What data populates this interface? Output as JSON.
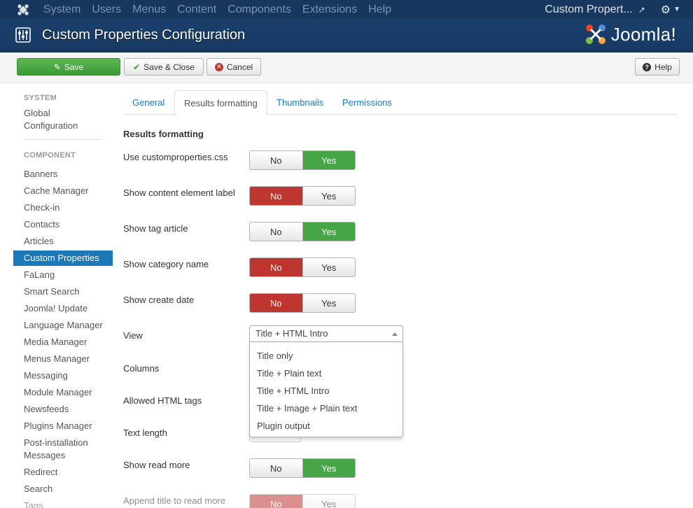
{
  "topbar": {
    "menu": [
      "System",
      "Users",
      "Menus",
      "Content",
      "Components",
      "Extensions",
      "Help"
    ],
    "site_link": "Custom Propert...",
    "icons": [
      "joomla-icon",
      "external-link-icon",
      "gear-icon",
      "caret-down-icon"
    ]
  },
  "header": {
    "title": "Custom Properties Configuration",
    "brand": "Joomla!"
  },
  "toolbar": {
    "save": "Save",
    "save_close": "Save & Close",
    "cancel": "Cancel",
    "help": "Help"
  },
  "sidebar": {
    "system_head": "SYSTEM",
    "global_config": [
      "Global",
      "Configuration"
    ],
    "component_head": "COMPONENT",
    "items": [
      "Banners",
      "Cache Manager",
      "Check-in",
      "Contacts",
      "Articles",
      "Custom Properties",
      "FaLang",
      "Smart Search",
      "Joomla! Update",
      "Language Manager",
      "Media Manager",
      "Menus Manager",
      "Messaging",
      "Module Manager",
      "Newsfeeds",
      "Plugins Manager"
    ],
    "post_install": [
      "Post-installation",
      "Messages"
    ],
    "items2": [
      "Redirect",
      "Search",
      "Tags"
    ],
    "active": "Custom Properties"
  },
  "tabs": [
    "General",
    "Results formatting",
    "Thumbnails",
    "Permissions"
  ],
  "active_tab": "Results formatting",
  "form": {
    "section_title": "Results formatting",
    "fields": [
      {
        "label": "Use customproperties.css",
        "value": "Yes"
      },
      {
        "label": "Show content element label",
        "value": "No"
      },
      {
        "label": "Show tag article",
        "value": "Yes"
      },
      {
        "label": "Show category name",
        "value": "No"
      },
      {
        "label": "Show create date",
        "value": "No"
      }
    ],
    "toggle_no": "No",
    "toggle_yes": "Yes",
    "view_label": "View",
    "view_selected": "Title + HTML Intro",
    "view_options": [
      "Title only",
      "Title + Plain text",
      "Title + HTML Intro",
      "Title + Image + Plain text",
      "Plugin output"
    ],
    "columns_label": "Columns",
    "allowed_html_label": "Allowed HTML tags",
    "text_length_label": "Text length",
    "show_read_more": {
      "label": "Show read more",
      "value": "Yes"
    },
    "append_title": {
      "label": "Append title to read more",
      "value": "No"
    }
  },
  "colors": {
    "navbar": "#17375e",
    "header": "#1a3f6b",
    "accent": "#1a7ab9",
    "yes_green": "#46a546",
    "no_red": "#bd362f"
  }
}
